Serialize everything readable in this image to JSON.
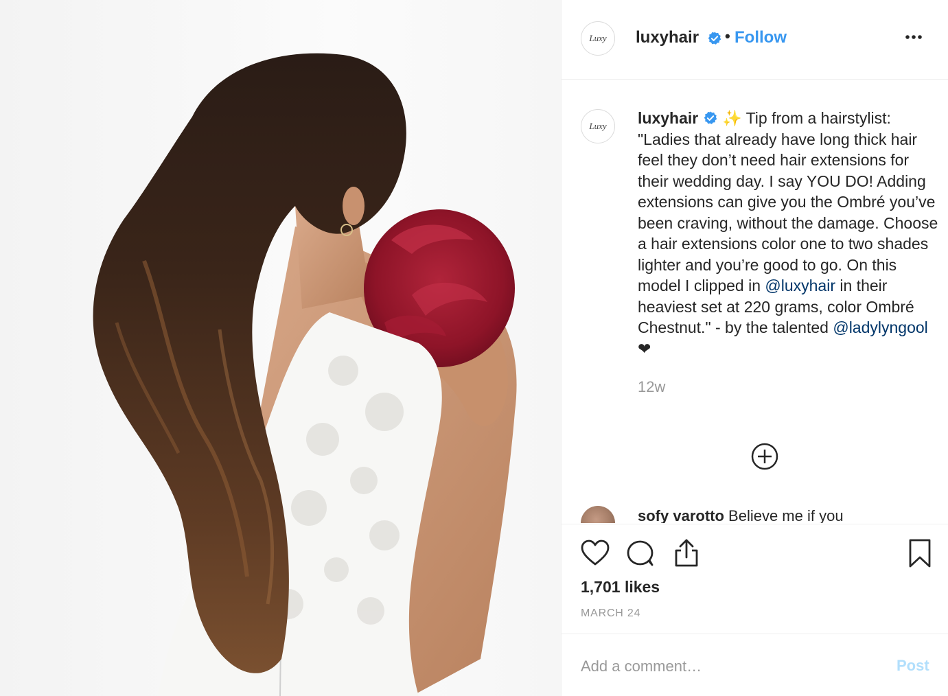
{
  "header": {
    "avatar_text": "Luxy",
    "username": "luxyhair",
    "separator": "•",
    "follow_label": "Follow"
  },
  "caption": {
    "username": "luxyhair",
    "sparkle": "✨",
    "text_1": " Tip from a hairstylist: \"Ladies that already have long thick hair feel they don’t need hair extensions for their wedding day. I say YOU DO! Adding extensions can give you the Ombré you’ve been craving, without the damage. Choose a hair extensions color one to two shades lighter and you’re good to go. On this model I clipped in ",
    "mention_1": "@luxyhair",
    "text_2": " in their heaviest set at 220 grams, color Ombré Chestnut.\" - by the talented ",
    "mention_2": "@ladylyngool",
    "heart": " ❤",
    "time": "12w"
  },
  "next_comment": {
    "username": "sofy varotto",
    "text": " Believe me if you"
  },
  "engagement": {
    "likes": "1,701 likes",
    "date": "MARCH 24"
  },
  "add_comment": {
    "placeholder": "Add a comment…",
    "post_label": "Post"
  },
  "icons": {
    "verified": "verified-badge-icon",
    "more": "more-options-icon",
    "load_more": "plus-circle-icon",
    "like": "heart-icon",
    "comment": "comment-bubble-icon",
    "share": "share-icon",
    "save": "bookmark-icon"
  },
  "colors": {
    "link": "#3897f0",
    "mention": "#003569",
    "verified": "#3897f0",
    "muted": "#999999",
    "post_disabled": "#b2dffc"
  }
}
